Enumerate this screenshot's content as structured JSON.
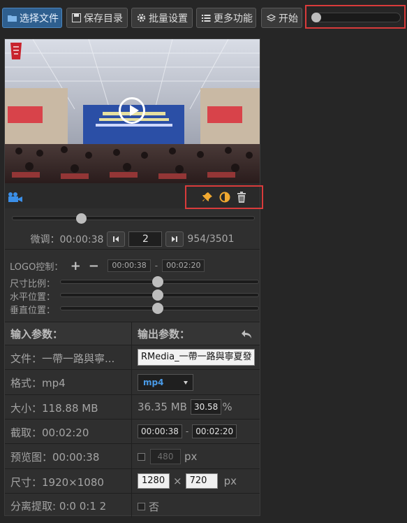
{
  "toolbar": {
    "select_file": "选择文件",
    "save_dir": "保存目录",
    "batch_settings": "批量设置",
    "more_functions": "更多功能",
    "start": "开始"
  },
  "video": {
    "frame_current": "2",
    "frame_info": "954/3501",
    "fine_label": "微调：",
    "fine_time": "00:00:38"
  },
  "logo": {
    "label": "LOGO控制：",
    "plus": "+",
    "minus": "−",
    "start": "00:00:38",
    "dash": "-",
    "end": "00:02:20",
    "scale_label": "尺寸比例：",
    "hpos_label": "水平位置：",
    "vpos_label": "垂直位置："
  },
  "params": {
    "input_header": "输入参数：",
    "output_header": "输出参数：",
    "file_label": "文件：一帶一路與寧...",
    "output_name": "RMedia_一帶一路與寧夏發",
    "format_label": "格式：mp4",
    "format_option": "mp4",
    "size_label": "大小：118.88 MB",
    "output_size": "36.35 MB",
    "percent_value": "30.58",
    "percent_sign": "%",
    "cut_label": "截取：00:02:20",
    "cut_start": "00:00:38",
    "cut_dash": "-",
    "cut_end": "00:02:20",
    "preview_label": "预览图：00:00:38",
    "preview_width": "480",
    "px": "px",
    "dim_label": "尺寸：1920×1080",
    "width": "1280",
    "times": "×",
    "height": "720",
    "separate_label": "分离提取: 0:0 0:1 2",
    "separate_no": "否"
  },
  "colors": {
    "accent": "#2e5f8f",
    "highlight_box": "#d93b3b",
    "icon_orange": "#f0a830"
  },
  "sliders": {
    "toolbar_progress": 0,
    "seek_position": 0.27,
    "logo_scale": 0.5,
    "logo_hpos": 0.5,
    "logo_vpos": 0.5
  }
}
